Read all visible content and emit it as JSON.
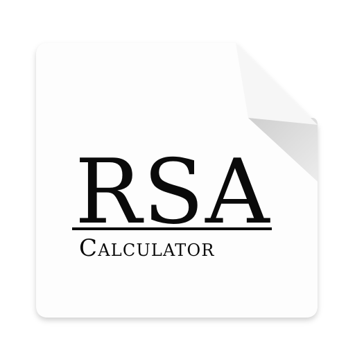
{
  "app_icon": {
    "title": "RSA",
    "subtitle": "Calculator",
    "icon_name": "rsa-calculator-document-icon",
    "colors": {
      "card": "#ffffff",
      "fold": "#e2e2e2",
      "text": "#0a0a0a",
      "shadow": "#d9d9d9"
    }
  }
}
